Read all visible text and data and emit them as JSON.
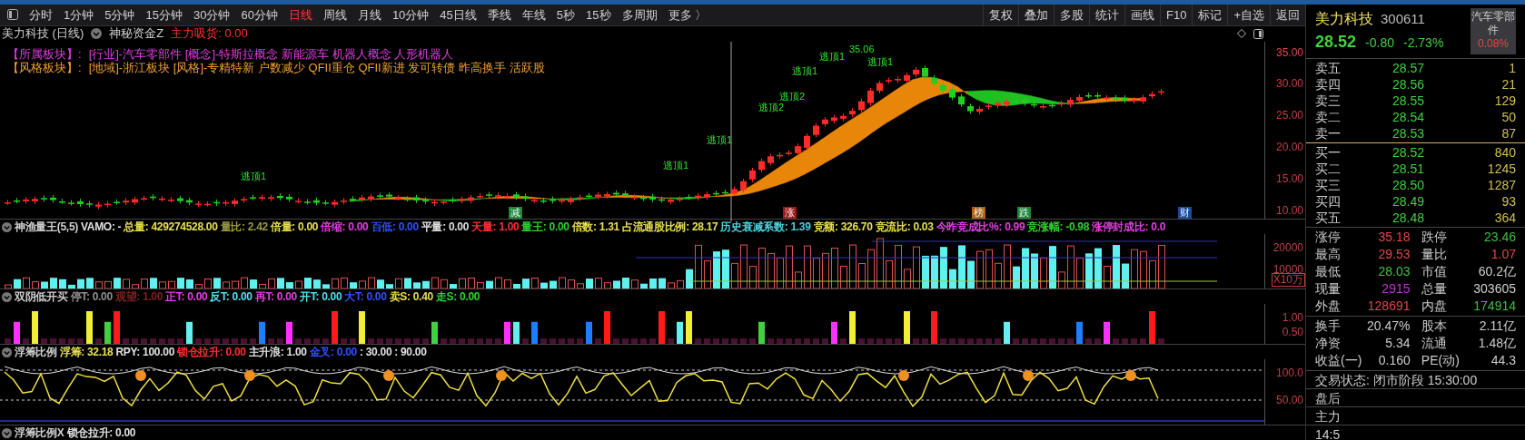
{
  "toolbar": {
    "periods": [
      {
        "label": "分时",
        "selected": false
      },
      {
        "label": "1分钟",
        "selected": false
      },
      {
        "label": "5分钟",
        "selected": false
      },
      {
        "label": "15分钟",
        "selected": false
      },
      {
        "label": "30分钟",
        "selected": false
      },
      {
        "label": "60分钟",
        "selected": false
      },
      {
        "label": "日线",
        "selected": true
      },
      {
        "label": "周线",
        "selected": false
      },
      {
        "label": "月线",
        "selected": false
      },
      {
        "label": "10分钟",
        "selected": false
      },
      {
        "label": "45日线",
        "selected": false
      },
      {
        "label": "季线",
        "selected": false
      },
      {
        "label": "年线",
        "selected": false
      },
      {
        "label": "5秒",
        "selected": false
      },
      {
        "label": "15秒",
        "selected": false
      },
      {
        "label": "多周期",
        "selected": false
      },
      {
        "label": "更多 〉",
        "selected": false
      }
    ],
    "tools": [
      "复权",
      "叠加",
      "多股",
      "统计",
      "画线",
      "F10",
      "标记",
      "+自选",
      "返回"
    ]
  },
  "main_chart": {
    "title": "美力科技 (日线)",
    "indicator": "神秘资金Z",
    "reading": "主力吸货: 0.00",
    "sector_lines": [
      {
        "label": "【所属板块】:",
        "text": "[行业]-汽车零部件 [概念]-特斯拉概念 新能源车 机器人概念 人形机器人",
        "color": "#e040e0"
      },
      {
        "label": "【风格板块】:",
        "text": "[地域]-浙江板块 [风格]-专精特新 户数减少 QFII重仓 QFII新进 发可转债 昨高换手 活跃股",
        "color": "#f0a030"
      }
    ],
    "price_ticks": [
      "35.00",
      "30.00",
      "25.00",
      "20.00",
      "15.00",
      "10.00"
    ],
    "signal_labels": [
      "逃顶1",
      "逃顶1",
      "逃顶1",
      "逃顶2",
      "逃顶2",
      "逃顶1",
      "逃顶1",
      "35.06",
      "逃顶1"
    ],
    "event_markers": [
      {
        "text": "减",
        "color": "#1a8a3a"
      },
      {
        "text": "涨",
        "color": "#a01818"
      },
      {
        "text": "榜",
        "color": "#b06010"
      },
      {
        "text": "跌",
        "color": "#1a8a3a"
      },
      {
        "text": "财",
        "color": "#1a4a9a"
      }
    ]
  },
  "volume_panel": {
    "title": "神渔量王(5,5)",
    "items": [
      {
        "text": "VAMO: -",
        "color": "#e0e0e0"
      },
      {
        "text": "总量: 429274528.00",
        "color": "#e8e050"
      },
      {
        "text": "量比: 2.42",
        "color": "#9a9a40"
      },
      {
        "text": "倍量: 0.00",
        "color": "#e8e050"
      },
      {
        "text": "倍缩: 0.00",
        "color": "#e040e0"
      },
      {
        "text": "百低: 0.00",
        "color": "#3050ff"
      },
      {
        "text": "平量: 0.00",
        "color": "#e0e0e0"
      },
      {
        "text": "天量: 1.00",
        "color": "#ff3030"
      },
      {
        "text": "量王: 0.00",
        "color": "#30d030"
      },
      {
        "text": "倍数: 1.31",
        "color": "#e8e050"
      },
      {
        "text": "占流通股比例: 28.17",
        "color": "#e8e050"
      },
      {
        "text": "历史衰减系数: 1.39",
        "color": "#50d0e0"
      },
      {
        "text": "竞额: 326.70",
        "color": "#e8e050"
      },
      {
        "text": "竞流比: 0.03",
        "color": "#e8e050"
      },
      {
        "text": "今昨竞成比%: 0.99",
        "color": "#e040e0"
      },
      {
        "text": "竞涨幅: -0.98",
        "color": "#30d030"
      },
      {
        "text": "涨停封成比: 0.0",
        "color": "#e040e0"
      }
    ],
    "axis_ticks": [
      "20000",
      "10000"
    ],
    "unit": "X10万"
  },
  "signal_panel": {
    "title": "双阴低开买",
    "items": [
      {
        "text": "停T: 0.00",
        "color": "#909090"
      },
      {
        "text": "观望: 1.00",
        "color": "#802020"
      },
      {
        "text": "正T: 0.00",
        "color": "#e040e0"
      },
      {
        "text": "反T: 0.00",
        "color": "#50e0f0"
      },
      {
        "text": "再T: 0.00",
        "color": "#e040e0"
      },
      {
        "text": "开T: 0.00",
        "color": "#50e0f0"
      },
      {
        "text": "大T: 0.00",
        "color": "#3050ff"
      },
      {
        "text": "卖S: 0.40",
        "color": "#e8e050"
      },
      {
        "text": "走S: 0.00",
        "color": "#30d030"
      }
    ],
    "axis_ticks": [
      "1.00",
      "0.50"
    ]
  },
  "float_panel": {
    "title": "浮筹比例",
    "items": [
      {
        "text": "浮筹: 32.18",
        "color": "#e8e050"
      },
      {
        "text": "RPY: 100.00",
        "color": "#e0e0e0"
      },
      {
        "text": "锁仓拉升: 0.00",
        "color": "#ff3030"
      },
      {
        "text": "主升浪: 1.00",
        "color": "#e0e0e0"
      },
      {
        "text": "金叉: 0.00",
        "color": "#3050ff"
      },
      {
        "text": ": 30.00",
        "color": "#e0e0e0"
      },
      {
        "text": ": 90.00",
        "color": "#e0e0e0"
      }
    ],
    "axis_ticks": [
      "100.0",
      "50.00"
    ]
  },
  "bottom_panel": {
    "title": "浮筹比例X",
    "items": [
      {
        "text": "锁仓拉升: 0.00",
        "color": "#e0e0e0"
      }
    ]
  },
  "quote": {
    "name": "美力科技",
    "code": "300611",
    "price": "28.52",
    "change": "-0.80",
    "change_pct": "-2.73%",
    "sector": "汽车零部件",
    "sector_change": "0.08%",
    "asks": [
      {
        "label": "卖五",
        "price": "28.57",
        "volume": "1"
      },
      {
        "label": "卖四",
        "price": "28.56",
        "volume": "21"
      },
      {
        "label": "卖三",
        "price": "28.55",
        "volume": "129"
      },
      {
        "label": "卖二",
        "price": "28.54",
        "volume": "50"
      },
      {
        "label": "卖一",
        "price": "28.53",
        "volume": "87"
      }
    ],
    "bids": [
      {
        "label": "买一",
        "price": "28.52",
        "volume": "840"
      },
      {
        "label": "买二",
        "price": "28.51",
        "volume": "1245"
      },
      {
        "label": "买三",
        "price": "28.50",
        "volume": "1287"
      },
      {
        "label": "买四",
        "price": "28.49",
        "volume": "93"
      },
      {
        "label": "买五",
        "price": "28.48",
        "volume": "364"
      }
    ],
    "stats": [
      [
        {
          "label": "涨停",
          "value": "35.18",
          "color": "#e04848"
        },
        {
          "label": "跌停",
          "value": "23.46",
          "color": "#40c040"
        }
      ],
      [
        {
          "label": "最高",
          "value": "29.53",
          "color": "#e04848"
        },
        {
          "label": "量比",
          "value": "1.07",
          "color": "#e04848"
        }
      ],
      [
        {
          "label": "最低",
          "value": "28.03",
          "color": "#40c040"
        },
        {
          "label": "市值",
          "value": "60.2亿",
          "color": "#d0d0d0"
        }
      ],
      [
        {
          "label": "现量",
          "value": "2915",
          "color": "#b040c0"
        },
        {
          "label": "总量",
          "value": "303605",
          "color": "#d0d0d0"
        }
      ],
      [
        {
          "label": "外盘",
          "value": "128691",
          "color": "#e04848"
        },
        {
          "label": "内盘",
          "value": "174914",
          "color": "#40c040"
        }
      ]
    ],
    "fundamentals": [
      [
        {
          "label": "换手",
          "value": "20.47%"
        },
        {
          "label": "股本",
          "value": "2.11亿"
        }
      ],
      [
        {
          "label": "净资",
          "value": "5.34"
        },
        {
          "label": "流通",
          "value": "1.48亿"
        }
      ],
      [
        {
          "label": "收益(一)",
          "value": "0.160"
        },
        {
          "label": "PE(动)",
          "value": "44.3"
        }
      ]
    ],
    "trade_status": "交易状态: 闭市阶段 15:30:00",
    "footer_rows": [
      "盘后",
      "主力",
      "14:5"
    ]
  }
}
